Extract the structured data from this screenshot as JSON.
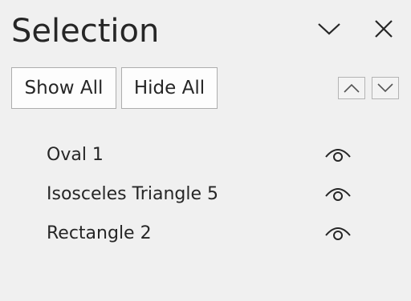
{
  "pane": {
    "title": "Selection",
    "collapse_icon": "chevron-down-icon",
    "close_icon": "close-icon"
  },
  "toolbar": {
    "show_all_label": "Show All",
    "hide_all_label": "Hide All",
    "bring_forward_icon": "chevron-up-icon",
    "send_backward_icon": "chevron-down-icon"
  },
  "objects": [
    {
      "name": "Oval 1",
      "visible": true,
      "icon": "eye-icon"
    },
    {
      "name": "Isosceles Triangle 5",
      "visible": true,
      "icon": "eye-icon"
    },
    {
      "name": "Rectangle 2",
      "visible": true,
      "icon": "eye-icon"
    }
  ],
  "colors": {
    "background": "#f0f0f0",
    "text": "#262626",
    "button_border": "#adadad"
  }
}
